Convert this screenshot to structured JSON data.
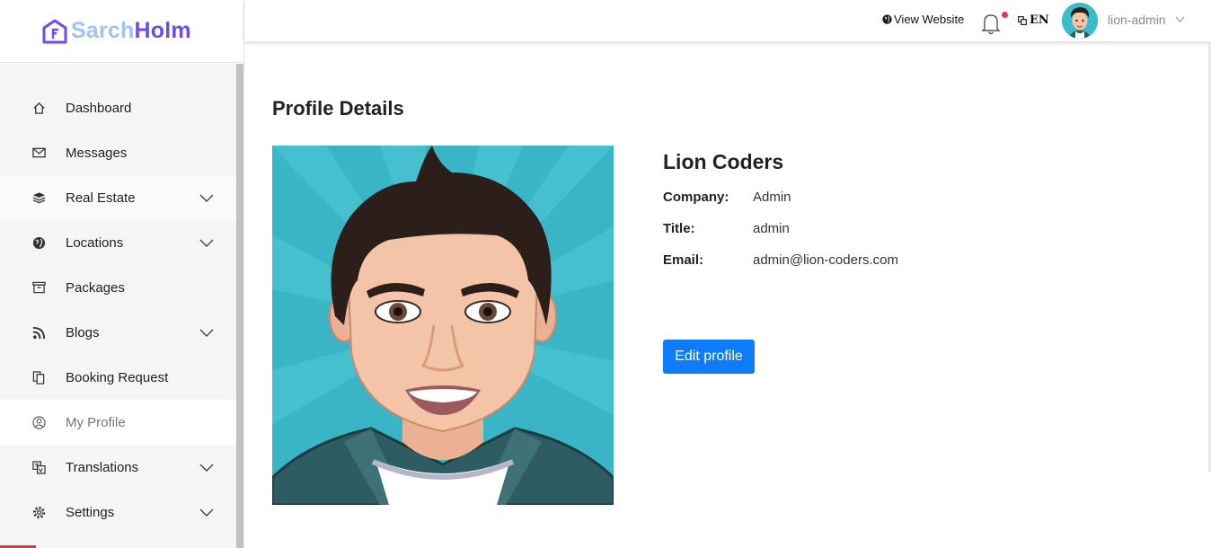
{
  "brand": {
    "part1": "Sarch",
    "part2": "Holm",
    "color1": "#9ec4f4",
    "color2": "#6a4cf0"
  },
  "header": {
    "view_website": "View Website",
    "language": "EN",
    "username": "lion-admin",
    "notification_dot_color": "#f0344d"
  },
  "sidebar": {
    "items": [
      {
        "label": "Dashboard",
        "icon": "home-icon"
      },
      {
        "label": "Messages",
        "icon": "envelope-icon"
      },
      {
        "label": "Real Estate",
        "icon": "layers-icon",
        "expandable": true
      },
      {
        "label": "Locations",
        "icon": "globe-icon",
        "expandable": true
      },
      {
        "label": "Packages",
        "icon": "archive-icon"
      },
      {
        "label": "Blogs",
        "icon": "rss-icon",
        "expandable": true
      },
      {
        "label": "Booking Request",
        "icon": "copy-icon"
      },
      {
        "label": "My Profile",
        "icon": "user-circle-icon",
        "active": true
      },
      {
        "label": "Translations",
        "icon": "translate-icon",
        "expandable": true
      },
      {
        "label": "Settings",
        "icon": "gear-icon",
        "expandable": true
      }
    ]
  },
  "main": {
    "page_title": "Profile Details",
    "profile": {
      "name": "Lion Coders",
      "company_label": "Company:",
      "company": "Admin",
      "title_label": "Title:",
      "title": "admin",
      "email_label": "Email:",
      "email": "admin@lion-coders.com"
    },
    "edit_button": "Edit profile",
    "button_color": "#0d7dfd"
  }
}
